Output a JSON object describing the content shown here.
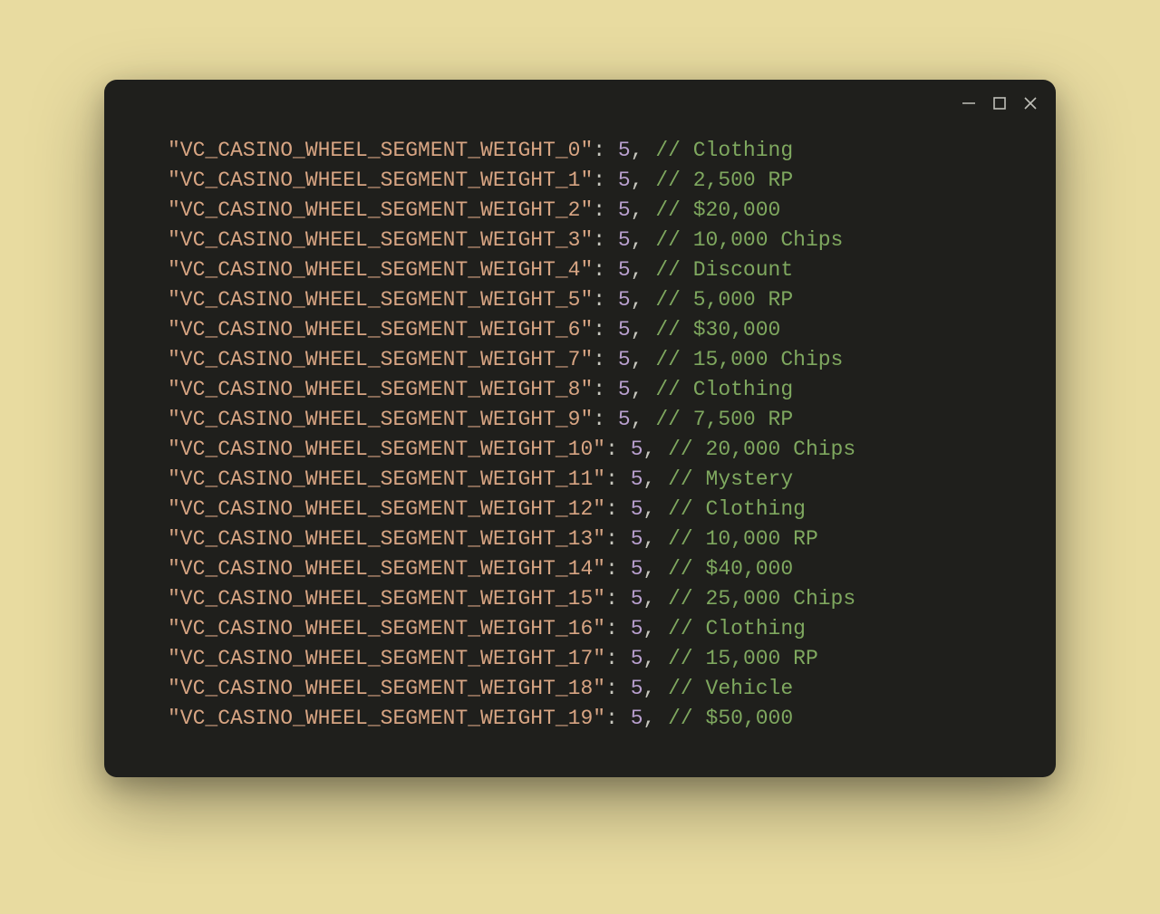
{
  "colors": {
    "page_bg": "#e8dba0",
    "window_bg": "#1f1f1c",
    "key": "#d8a583",
    "punct": "#c7c7be",
    "number": "#b9a0cf",
    "comment": "#7fa85f"
  },
  "window_controls": {
    "minimize": "minimize",
    "maximize": "maximize",
    "close": "close"
  },
  "code": {
    "lines": [
      {
        "key": "\"VC_CASINO_WHEEL_SEGMENT_WEIGHT_0\"",
        "colon": ": ",
        "value": "5",
        "comma": ", ",
        "comment": "// Clothing"
      },
      {
        "key": "\"VC_CASINO_WHEEL_SEGMENT_WEIGHT_1\"",
        "colon": ": ",
        "value": "5",
        "comma": ", ",
        "comment": "// 2,500 RP"
      },
      {
        "key": "\"VC_CASINO_WHEEL_SEGMENT_WEIGHT_2\"",
        "colon": ": ",
        "value": "5",
        "comma": ", ",
        "comment": "// $20,000"
      },
      {
        "key": "\"VC_CASINO_WHEEL_SEGMENT_WEIGHT_3\"",
        "colon": ": ",
        "value": "5",
        "comma": ", ",
        "comment": "// 10,000 Chips"
      },
      {
        "key": "\"VC_CASINO_WHEEL_SEGMENT_WEIGHT_4\"",
        "colon": ": ",
        "value": "5",
        "comma": ", ",
        "comment": "// Discount"
      },
      {
        "key": "\"VC_CASINO_WHEEL_SEGMENT_WEIGHT_5\"",
        "colon": ": ",
        "value": "5",
        "comma": ", ",
        "comment": "// 5,000 RP"
      },
      {
        "key": "\"VC_CASINO_WHEEL_SEGMENT_WEIGHT_6\"",
        "colon": ": ",
        "value": "5",
        "comma": ", ",
        "comment": "// $30,000"
      },
      {
        "key": "\"VC_CASINO_WHEEL_SEGMENT_WEIGHT_7\"",
        "colon": ": ",
        "value": "5",
        "comma": ", ",
        "comment": "// 15,000 Chips"
      },
      {
        "key": "\"VC_CASINO_WHEEL_SEGMENT_WEIGHT_8\"",
        "colon": ": ",
        "value": "5",
        "comma": ", ",
        "comment": "// Clothing"
      },
      {
        "key": "\"VC_CASINO_WHEEL_SEGMENT_WEIGHT_9\"",
        "colon": ": ",
        "value": "5",
        "comma": ", ",
        "comment": "// 7,500 RP"
      },
      {
        "key": "\"VC_CASINO_WHEEL_SEGMENT_WEIGHT_10\"",
        "colon": ": ",
        "value": "5",
        "comma": ", ",
        "comment": "// 20,000 Chips"
      },
      {
        "key": "\"VC_CASINO_WHEEL_SEGMENT_WEIGHT_11\"",
        "colon": ": ",
        "value": "5",
        "comma": ", ",
        "comment": "// Mystery"
      },
      {
        "key": "\"VC_CASINO_WHEEL_SEGMENT_WEIGHT_12\"",
        "colon": ": ",
        "value": "5",
        "comma": ", ",
        "comment": "// Clothing"
      },
      {
        "key": "\"VC_CASINO_WHEEL_SEGMENT_WEIGHT_13\"",
        "colon": ": ",
        "value": "5",
        "comma": ", ",
        "comment": "// 10,000 RP"
      },
      {
        "key": "\"VC_CASINO_WHEEL_SEGMENT_WEIGHT_14\"",
        "colon": ": ",
        "value": "5",
        "comma": ", ",
        "comment": "// $40,000"
      },
      {
        "key": "\"VC_CASINO_WHEEL_SEGMENT_WEIGHT_15\"",
        "colon": ": ",
        "value": "5",
        "comma": ", ",
        "comment": "// 25,000 Chips"
      },
      {
        "key": "\"VC_CASINO_WHEEL_SEGMENT_WEIGHT_16\"",
        "colon": ": ",
        "value": "5",
        "comma": ", ",
        "comment": "// Clothing"
      },
      {
        "key": "\"VC_CASINO_WHEEL_SEGMENT_WEIGHT_17\"",
        "colon": ": ",
        "value": "5",
        "comma": ", ",
        "comment": "// 15,000 RP"
      },
      {
        "key": "\"VC_CASINO_WHEEL_SEGMENT_WEIGHT_18\"",
        "colon": ": ",
        "value": "5",
        "comma": ", ",
        "comment": "// Vehicle"
      },
      {
        "key": "\"VC_CASINO_WHEEL_SEGMENT_WEIGHT_19\"",
        "colon": ": ",
        "value": "5",
        "comma": ", ",
        "comment": "// $50,000"
      }
    ]
  }
}
